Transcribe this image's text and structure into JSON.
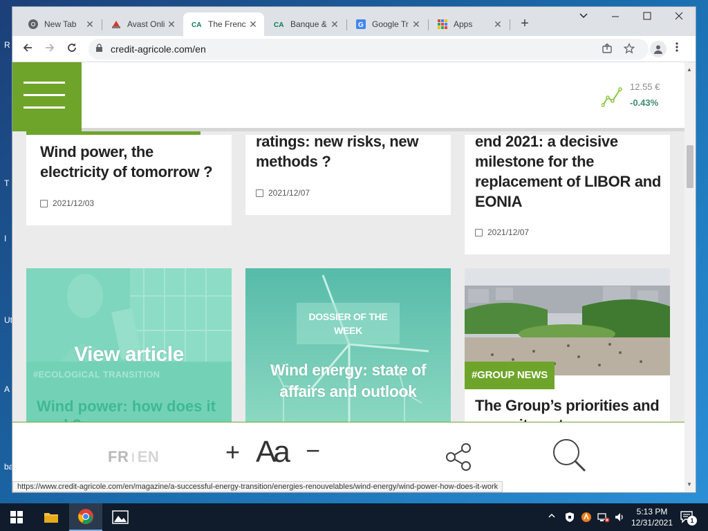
{
  "desktop": {
    "edge_labels": [
      "R",
      "T",
      "I",
      "Ut",
      "A",
      "ba"
    ]
  },
  "browser": {
    "tabs": [
      {
        "title": "New Tab",
        "icon": "chrome-icon"
      },
      {
        "title": "Avast Onli",
        "icon": "avast-icon"
      },
      {
        "title": "The Frenc",
        "icon": "credit-agricole-icon",
        "active": true
      },
      {
        "title": "Banque &",
        "icon": "credit-agricole-icon"
      },
      {
        "title": "Google Tr",
        "icon": "google-translate-icon"
      },
      {
        "title": "Apps",
        "icon": "apps-grid-icon"
      }
    ],
    "url": "credit-agricole.com/en",
    "status_url": "https://www.credit-agricole.com/en/magazine/a-successful-energy-transition/energies-renouvelables/wind-energy/wind-power-how-does-it-work"
  },
  "site": {
    "stock": {
      "price": "12.55 €",
      "change": "-0.43%"
    },
    "articles_top": [
      {
        "title": "Wind power, the electricity of tomorrow ?",
        "date": "2021/12/03"
      },
      {
        "title": "ratings: new risks, new methods ?",
        "date": "2021/12/07"
      },
      {
        "title": "end 2021: a decisive milestone for the replacement of LIBOR and EONIA",
        "date": "2021/12/07"
      }
    ],
    "card_hover": {
      "cta": "View article",
      "tag": "#ECOLOGICAL TRANSITION",
      "title": "Wind power: how does it work?"
    },
    "card_dossier": {
      "badge": "DOSSIER OF THE WEEK",
      "title": "Wind energy: state of affairs and outlook"
    },
    "card_group": {
      "tag": "#GROUP NEWS",
      "title": "The Group’s priorities and commitments"
    },
    "bottom": {
      "lang_fr": "FR",
      "lang_sep": "|",
      "lang_en": "EN",
      "font_plus": "+",
      "font_label": "Aa",
      "font_minus": "−"
    }
  },
  "taskbar": {
    "time": "5:13 PM",
    "date": "12/31/2021",
    "notification_count": "1"
  }
}
